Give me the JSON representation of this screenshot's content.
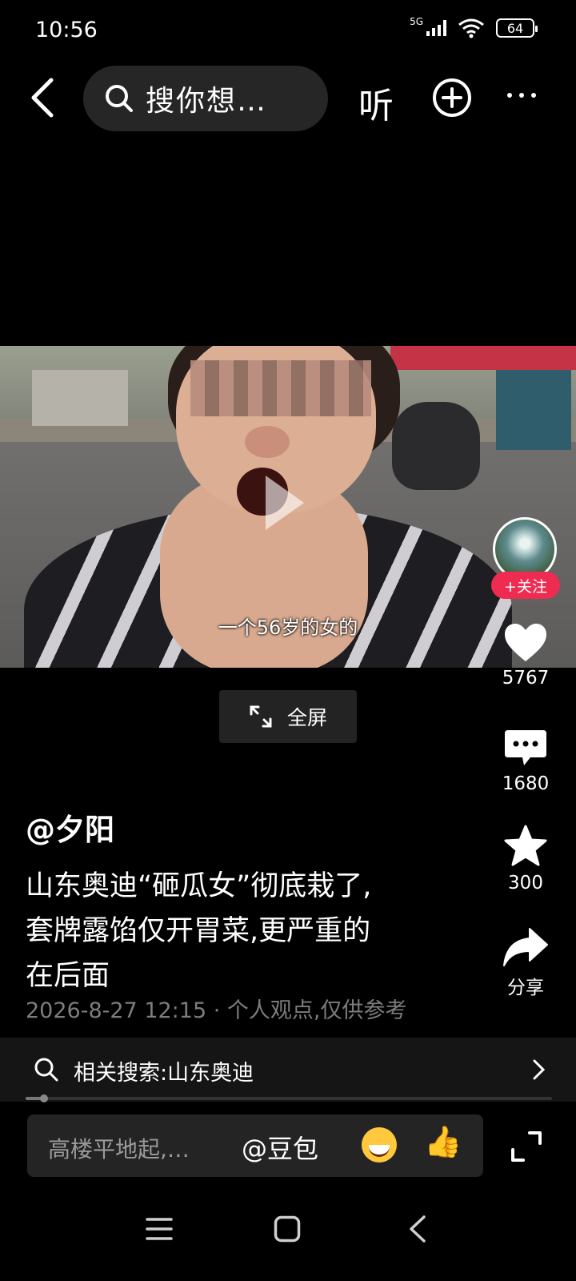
{
  "status_bar": {
    "time": "10:56",
    "network": "5G",
    "battery": "64"
  },
  "top_nav": {
    "search_placeholder": "搜你想…",
    "listen_label": "听"
  },
  "video": {
    "subtitle": "一个56岁的女的",
    "fullscreen_label": "全屏"
  },
  "rail": {
    "follow_label": "+关注",
    "likes": "5767",
    "comments": "1680",
    "favorites": "300",
    "share_label": "分享"
  },
  "post": {
    "author": "@夕阳",
    "title_lines": [
      "山东奥迪“砸瓜女”彻底栽了,",
      "套牌露馅仅开胃菜,更严重的",
      "在后面"
    ],
    "meta": "2026-8-27 12:15 · 个人观点,仅供参考"
  },
  "related_search": {
    "label": "相关搜索:山东奥迪"
  },
  "progress": {
    "fraction": 0.035
  },
  "comment_bar": {
    "placeholder": "高楼平地起,…",
    "mention": "@豆包",
    "emoji_thumb": "👍"
  },
  "colors": {
    "accent_red": "#ee2b50",
    "background": "#000000"
  }
}
